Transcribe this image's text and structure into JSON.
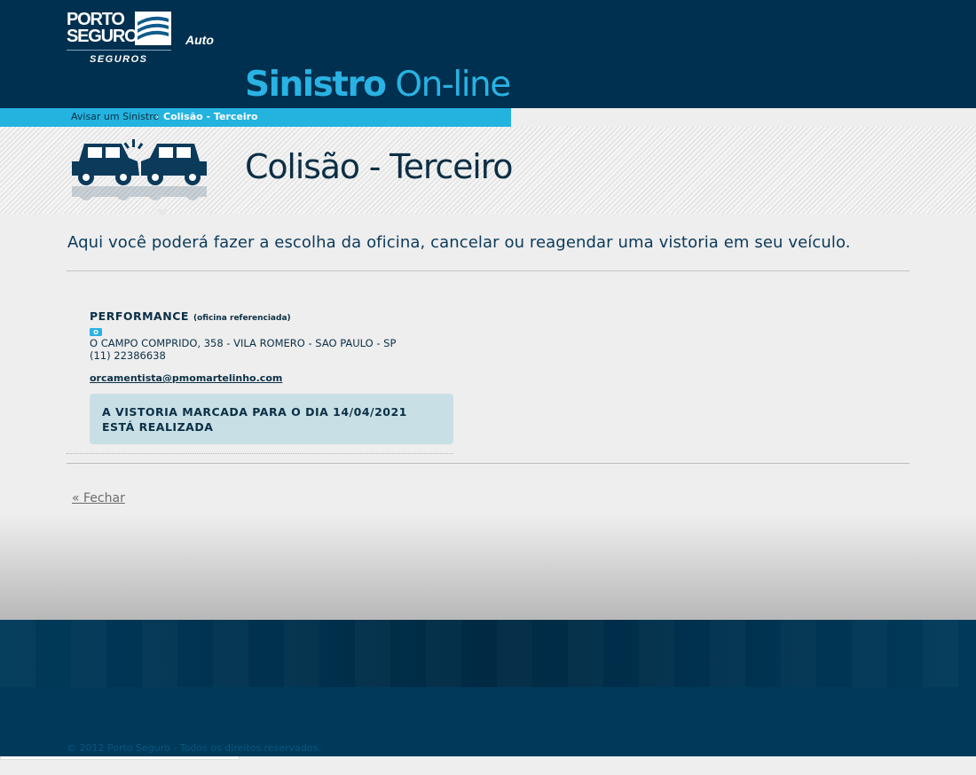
{
  "header": {
    "logo": {
      "line1": "PORTO",
      "line2": "SEGURO",
      "sub": "SEGUROS",
      "product": "Auto"
    },
    "app_title_bold": "Sinistro",
    "app_title_light": "On-line"
  },
  "breadcrumb": {
    "items": [
      {
        "label": "Avisar um Sinistro"
      },
      {
        "label": "Colisão - Terceiro"
      }
    ],
    "separator": "›"
  },
  "page": {
    "title": "Colisão - Terceiro",
    "icon": "car-collision-icon",
    "intro": "Aqui você poderá fazer a escolha da oficina, cancelar ou reagendar uma vistoria em seu veículo."
  },
  "workshop": {
    "name": "PERFORMANCE",
    "tag": "(oficina referenciada)",
    "icon": "camera-icon",
    "address": "O CAMPO COMPRIDO, 358 - VILA ROMERO - SAO PAULO - SP",
    "phone": "(11) 22386638",
    "email": "orcamentista@pmomartelinho.com",
    "status": "A VISTORIA MARCADA PARA O DIA 14/04/2021 ESTÁ REALIZADA"
  },
  "actions": {
    "close_label": "« Fechar"
  },
  "footer": {
    "copyright": "© 2012 Porto Seguro - Todos os direitos reservados."
  },
  "colors": {
    "header_bg": "#00304f",
    "accent": "#24b3df",
    "title_text": "#0b2f45",
    "status_bg": "#c8dfe5"
  }
}
